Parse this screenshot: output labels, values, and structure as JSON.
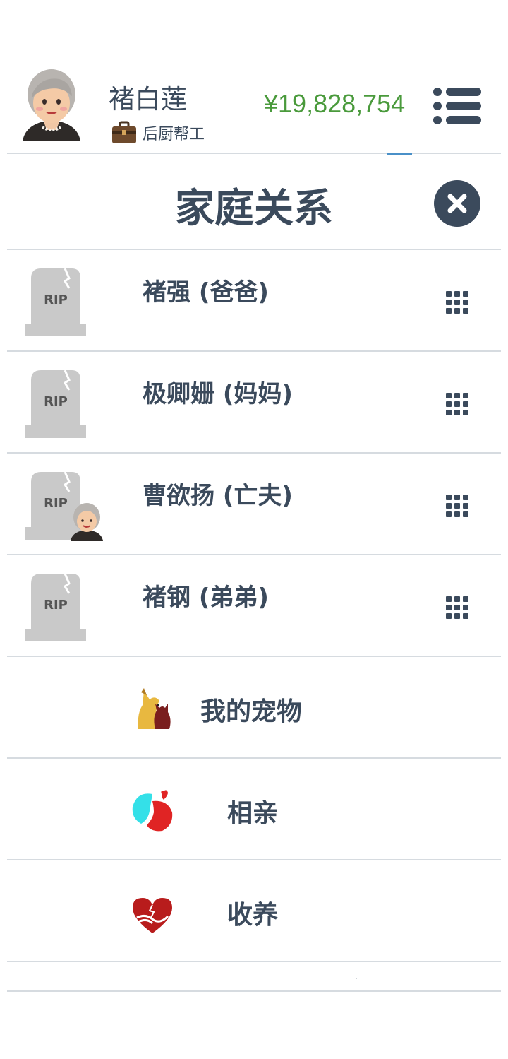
{
  "header": {
    "user_name": "褚白莲",
    "job": "后厨帮工",
    "money": "¥19,828,754",
    "avatar_icon": "elderly-woman-avatar-icon",
    "job_icon": "briefcase-icon",
    "menu_icon": "list-menu-icon"
  },
  "modal": {
    "title": "家庭关系",
    "close_icon": "close-icon"
  },
  "relatives": [
    {
      "label": "褚强 (爸爸)",
      "icon": "tombstone-rip-icon",
      "tomb_text": "RIP"
    },
    {
      "label": "极卿姗 (妈妈)",
      "icon": "tombstone-rip-icon",
      "tomb_text": "RIP"
    },
    {
      "label": "曹欲扬 (亡夫)",
      "icon": "tombstone-rip-icon",
      "tomb_text": "RIP"
    },
    {
      "label": "褚钢 (弟弟)",
      "icon": "tombstone-rip-icon",
      "tomb_text": "RIP"
    }
  ],
  "features": [
    {
      "label": "我的宠物",
      "icon": "pets-icon"
    },
    {
      "label": "相亲",
      "icon": "dating-icon"
    },
    {
      "label": "收养",
      "icon": "adoption-heart-icon"
    }
  ],
  "colors": {
    "text": "#3b4a5c",
    "money": "#4a9a3c",
    "separator": "#d6dbe0",
    "tombstone": "#c9c9c9",
    "close_button": "#3b4a5c"
  }
}
